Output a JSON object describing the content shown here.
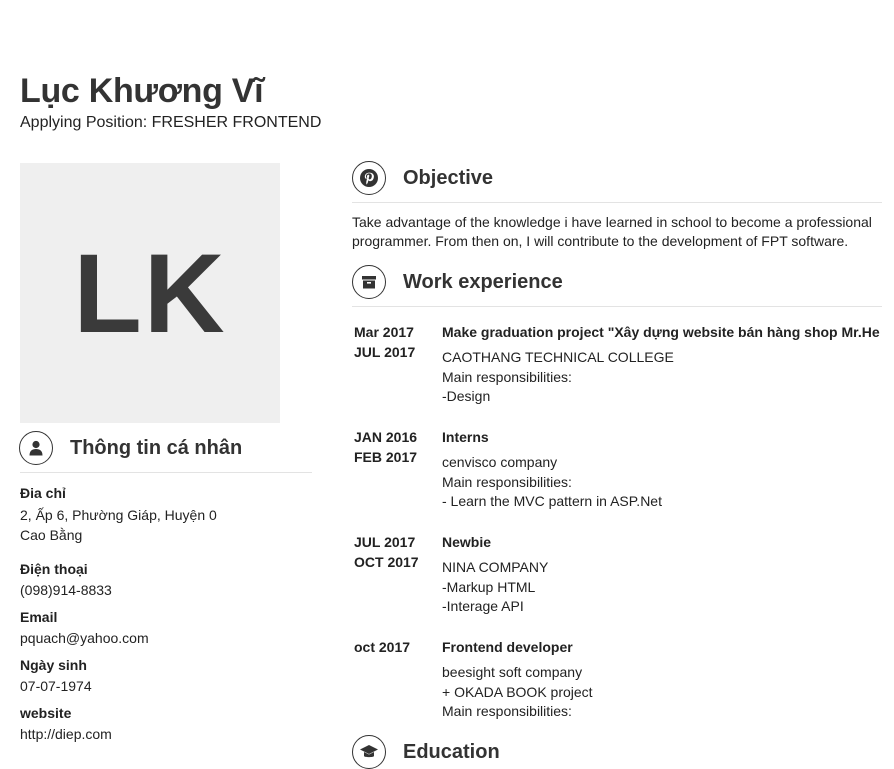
{
  "header": {
    "name": "Lục Khương Vĩ",
    "position": "Applying Position: FRESHER FRONTEND"
  },
  "avatar": {
    "initials": "LK"
  },
  "personal": {
    "title": "Thông tin cá nhân",
    "icon": "user-icon",
    "fields": [
      {
        "label": "Đia chỉ",
        "value": "2, Ấp 6, Phường Giáp, Huyện 0\nCao Bằng"
      },
      {
        "label": "Điện thoại",
        "value": "(098)914-8833"
      },
      {
        "label": "Email",
        "value": "pquach@yahoo.com"
      },
      {
        "label": "Ngày sinh",
        "value": "07-07-1974"
      },
      {
        "label": "website",
        "value": "http://diep.com"
      }
    ]
  },
  "objective": {
    "title": "Objective",
    "icon": "pinterest-icon",
    "text_lines": [
      "Take advantage of the knowledge i have learned in school to become a professional",
      "programmer. From then on, I will contribute to the development of FPT software."
    ]
  },
  "work": {
    "title": "Work experience",
    "icon": "archive-icon",
    "jobs": [
      {
        "start": "Mar 2017",
        "end": "JUL  2017",
        "title": "Make graduation project \"Xây dựng website bán hàng shop Mr.He",
        "lines": [
          "CAOTHANG TECHNICAL COLLEGE",
          "Main responsibilities:",
          "-Design"
        ]
      },
      {
        "start": "JAN 2016",
        "end": "FEB 2017",
        "title": "Interns",
        "lines": [
          "cenvisco company",
          "Main responsibilities:",
          "- Learn the MVC pattern in ASP.Net"
        ]
      },
      {
        "start": "JUL 2017",
        "end": "OCT 2017",
        "title": "Newbie",
        "lines": [
          "NINA COMPANY",
          "-Markup HTML",
          "-Interage API"
        ]
      },
      {
        "start": "oct 2017",
        "end": "",
        "title": "Frontend developer",
        "lines": [
          "beesight soft company",
          "+ OKADA BOOK project",
          "Main responsibilities:"
        ]
      }
    ]
  },
  "education": {
    "title": "Education",
    "icon": "graduation-cap-icon"
  }
}
